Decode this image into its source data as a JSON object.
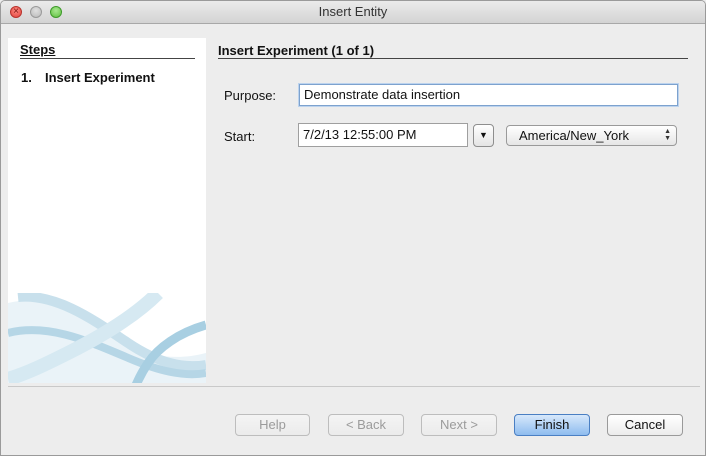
{
  "window": {
    "title": "Insert Entity"
  },
  "steps": {
    "heading": "Steps",
    "items": [
      {
        "number": "1.",
        "label": "Insert Experiment"
      }
    ]
  },
  "panel": {
    "heading": "Insert Experiment (1 of 1)",
    "purpose": {
      "label": "Purpose:",
      "value": "Demonstrate data insertion"
    },
    "start": {
      "label": "Start:",
      "value": "7/2/13 12:55:00 PM",
      "timezone": "America/New_York"
    }
  },
  "buttons": {
    "help": "Help",
    "back": "< Back",
    "next": "Next >",
    "finish": "Finish",
    "cancel": "Cancel"
  },
  "colors": {
    "default_button": "#8ebcef",
    "focus_ring": "#7da2ce",
    "close_light": "#e0443e"
  }
}
